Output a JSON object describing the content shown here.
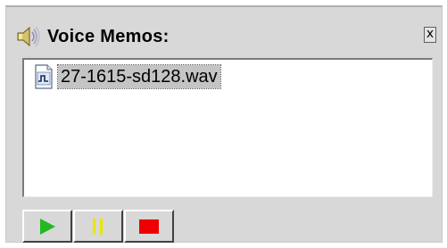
{
  "panel": {
    "title": "Voice Memos:",
    "close_label": "x",
    "speaker_icon": "speaker-icon"
  },
  "memos": [
    {
      "file_name": "27-1615-sd128.wav",
      "icon": "audio-file-icon",
      "selected": true
    }
  ],
  "controls": {
    "play": {
      "icon": "play-icon",
      "color": "#22b822"
    },
    "pause": {
      "icon": "pause-icon",
      "color": "#e8e800"
    },
    "stop": {
      "icon": "stop-icon",
      "color": "#ee0000"
    }
  }
}
